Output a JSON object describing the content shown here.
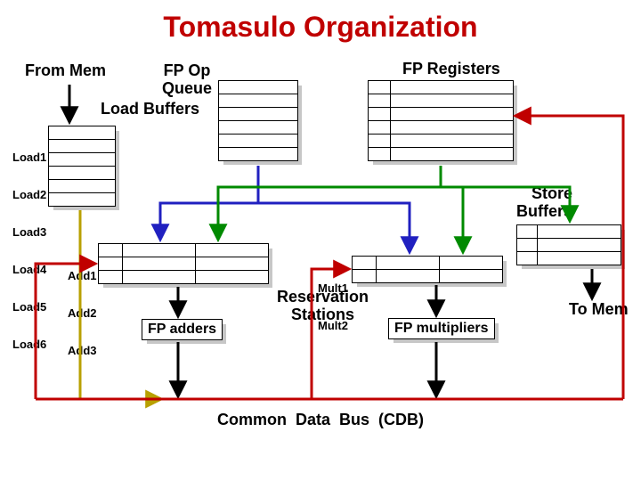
{
  "title": "Tomasulo Organization",
  "labels": {
    "from_mem": "From Mem",
    "fp_op_queue": "FP Op\nQueue",
    "load_buffers": "Load Buffers",
    "fp_registers": "FP Registers",
    "store_buffers": "Store\nBuffers",
    "reservation_stations": "Reservation\nStations",
    "to_mem": "To Mem",
    "cdb": "Common  Data  Bus  (CDB)"
  },
  "units": {
    "fp_adders": "FP adders",
    "fp_multipliers": "FP multipliers"
  },
  "load_rows": [
    "Load1",
    "Load2",
    "Load3",
    "Load4",
    "Load5",
    "Load6"
  ],
  "add_rows": [
    "Add1",
    "Add2",
    "Add3"
  ],
  "mult_rows": [
    "Mult1",
    "Mult2"
  ],
  "colors": {
    "red": "#c00000",
    "blue": "#2020c0",
    "green": "#008a00",
    "gold": "#b8a000"
  }
}
